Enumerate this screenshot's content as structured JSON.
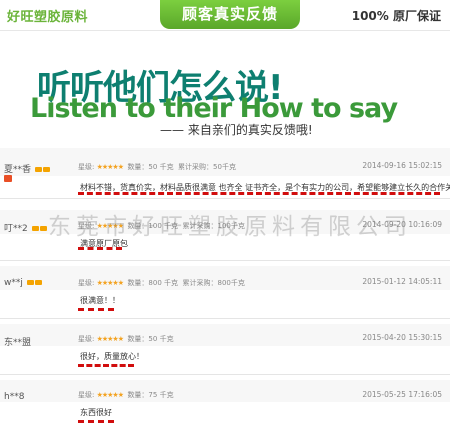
{
  "header": {
    "brand": "好旺塑胶原料",
    "tab": "顾客真实反馈",
    "guarantee": "100% 原厂保证"
  },
  "hero": {
    "cn": "听听他们怎么说!",
    "en": "Listen to their How to say",
    "sub": "—— 来自亲们的真实反馈哦!"
  },
  "watermark": "东莞市好旺塑胶原料有限公司",
  "reviews": [
    {
      "user": "夏**香",
      "rating_label": "星级:",
      "stars": "★★★★★",
      "qty": "数量：50 千克",
      "total": "累计采购：50千克",
      "date": "2014-09-16 15:02:15",
      "comment": "材料不错，货真价实，材料品质很满意 也齐全 证书齐全，是个有实力的公司，希望能够建立长久的合作关系"
    },
    {
      "user": "叮**2",
      "rating_label": "星级:",
      "stars": "★★★★★",
      "qty": "数量：100 千克",
      "total": "累计采购：100千克",
      "date": "2014-09-20 10:16:09",
      "comment": "满意原厂原包"
    },
    {
      "user": "w**j",
      "rating_label": "星级:",
      "stars": "★★★★★",
      "qty": "数量：800 千克",
      "total": "累计采购：800千克",
      "date": "2015-01-12 14:05:11",
      "comment": "很满意！！"
    },
    {
      "user": "东**盟",
      "rating_label": "星级:",
      "stars": "★★★★★",
      "qty": "数量：50 千克",
      "total": "",
      "date": "2015-04-20 15:30:15",
      "comment": "很好，质量放心！"
    },
    {
      "user": "h**8",
      "rating_label": "星级:",
      "stars": "★★★★★",
      "qty": "数量：75 千克",
      "total": "",
      "date": "2015-05-25 17:16:05",
      "comment": "东西很好"
    }
  ]
}
